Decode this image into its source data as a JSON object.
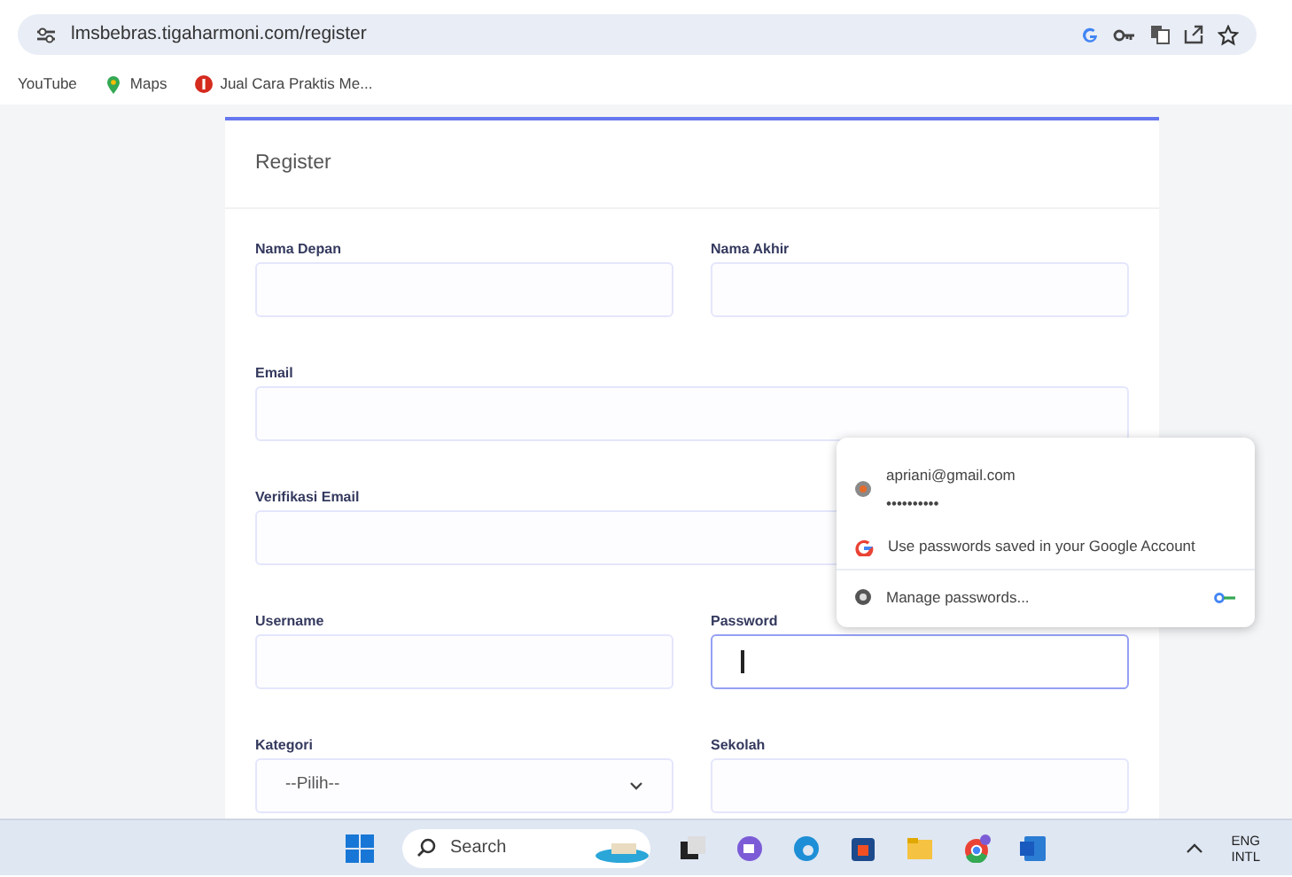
{
  "browser": {
    "address": "lmsbebras.tigaharmoni.com/register",
    "bookmarks": [
      {
        "kind": "youtube",
        "label": "YouTube"
      },
      {
        "kind": "maps",
        "label": "Maps"
      },
      {
        "kind": "site",
        "label": "Jual Cara Praktis Me..."
      }
    ]
  },
  "form": {
    "title": "Register",
    "rows": [
      {
        "fields": [
          {
            "label": "Nama Depan",
            "kind": "input",
            "focused": false
          },
          {
            "label": "Nama Akhir",
            "kind": "input",
            "focused": false
          }
        ]
      },
      {
        "fields": [
          {
            "label": "Email",
            "kind": "input",
            "focused": false
          }
        ]
      },
      {
        "fields": [
          {
            "label": "Verifikasi Email",
            "kind": "input",
            "focused": false
          }
        ]
      },
      {
        "fields": [
          {
            "label": "Username",
            "kind": "input",
            "focused": false
          },
          {
            "label": "Password",
            "kind": "input",
            "focused": true
          }
        ]
      },
      {
        "fields": [
          {
            "label": "Kategori",
            "kind": "select",
            "value": "--Pilih--",
            "focused": false
          },
          {
            "label": "Sekolah",
            "kind": "input",
            "focused": false
          }
        ]
      }
    ]
  },
  "password_popup": {
    "account": "apriani@gmail.com",
    "masked_password": "••••••••••",
    "google_option": "Use passwords saved in your Google Account",
    "manage": "Manage passwords..."
  },
  "taskbar": {
    "search": "Search",
    "language": "ENG",
    "layout": "INTL"
  }
}
